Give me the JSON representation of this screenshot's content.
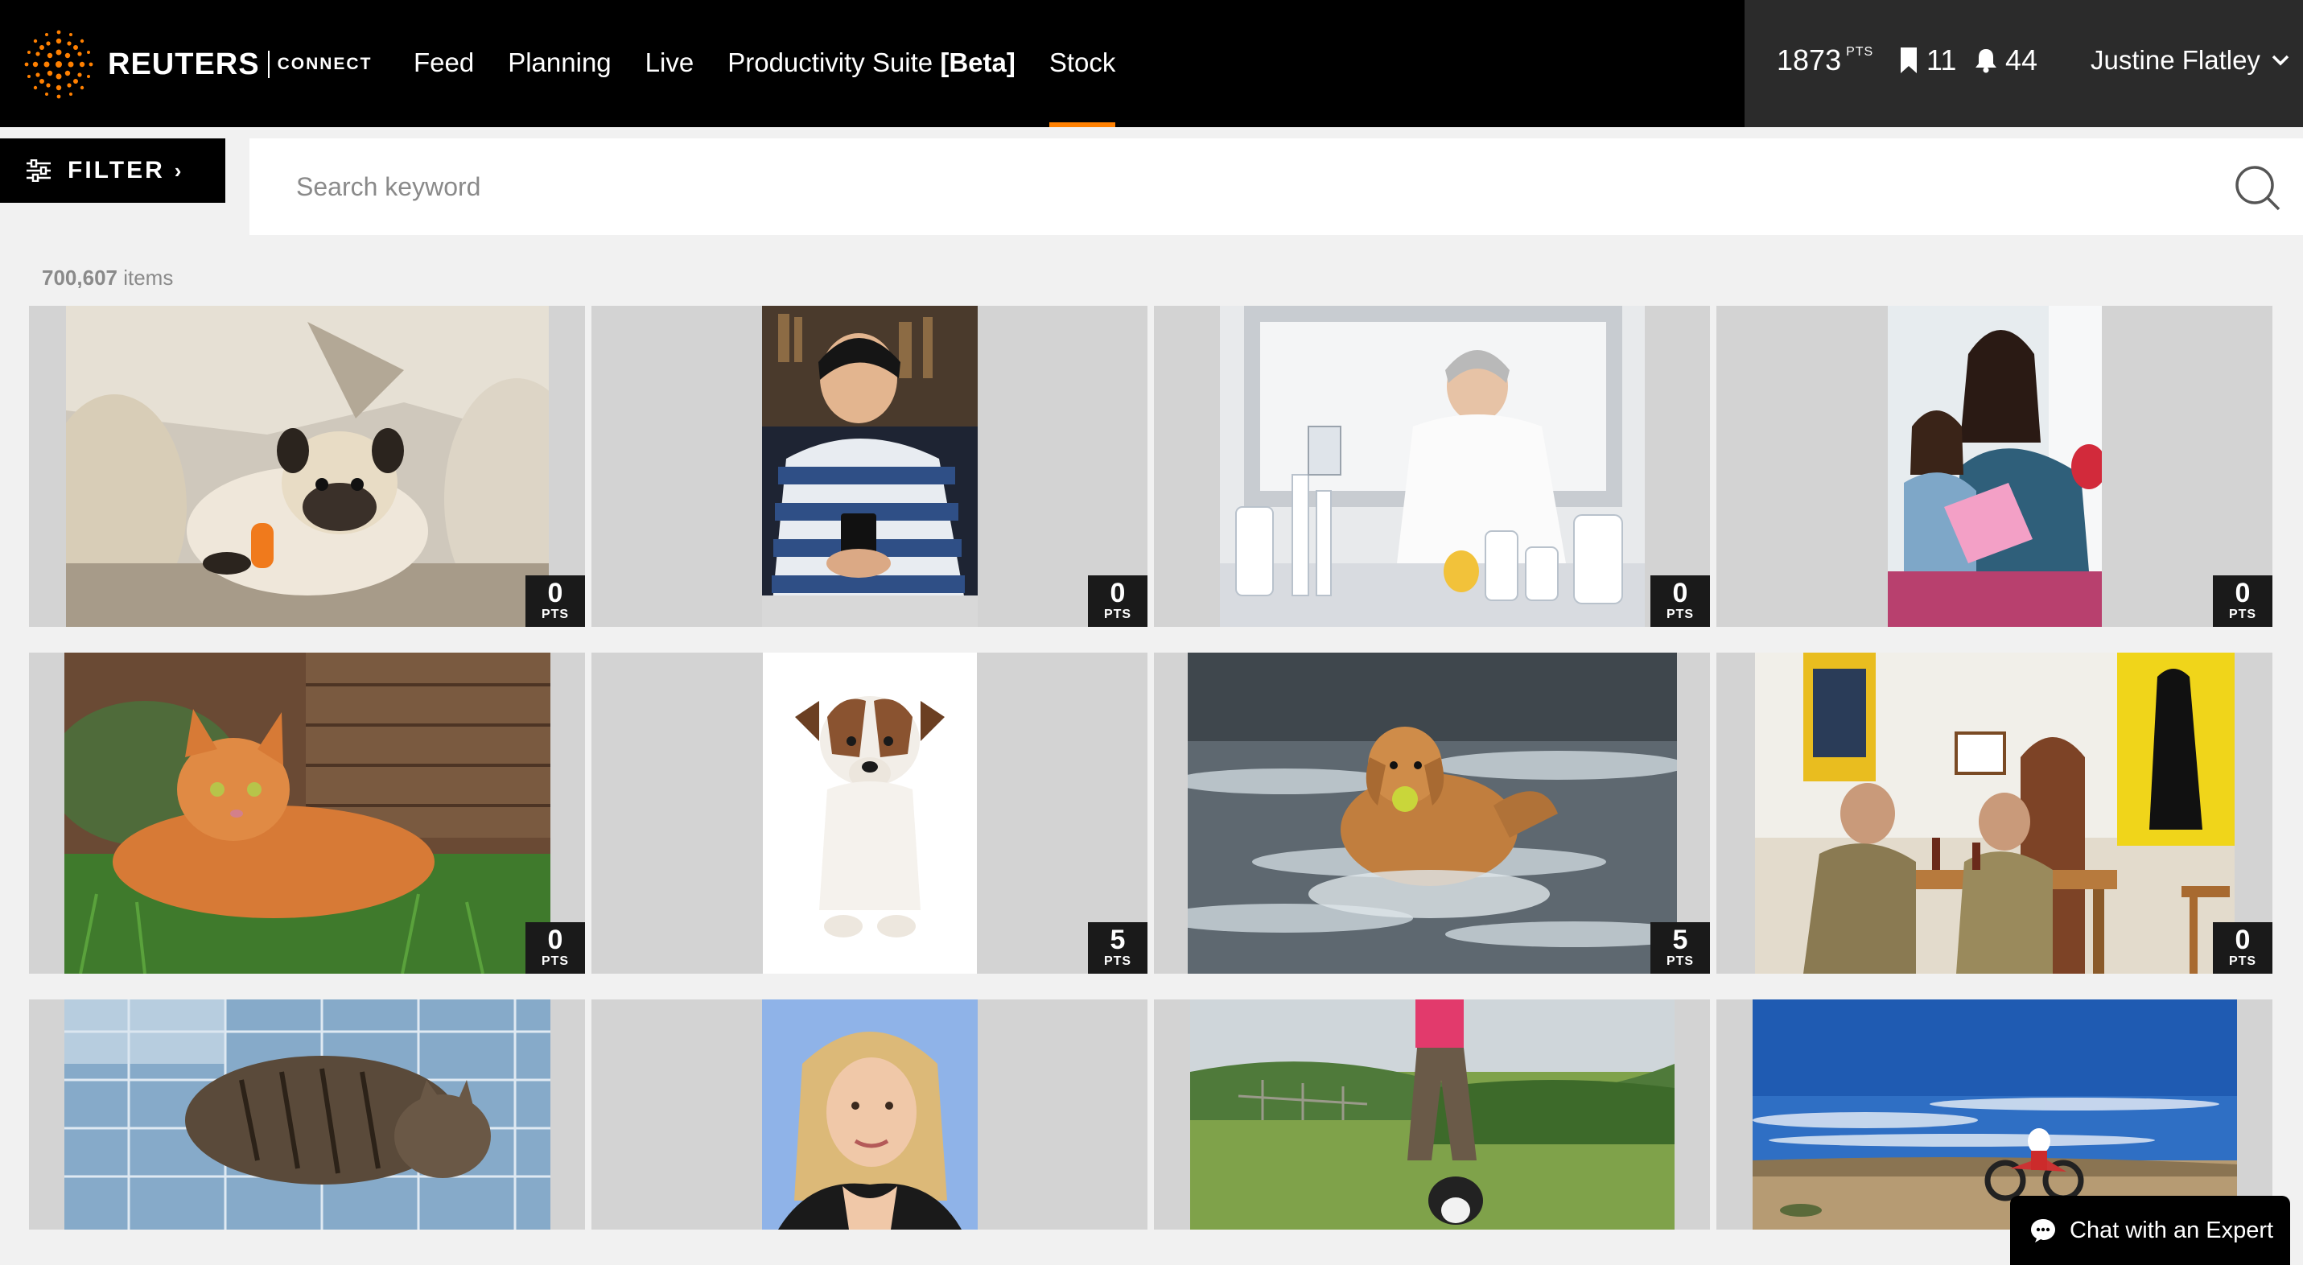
{
  "header": {
    "brand": "REUTERS",
    "brand_sub": "CONNECT",
    "nav": [
      {
        "label": "Feed"
      },
      {
        "label": "Planning"
      },
      {
        "label": "Live"
      },
      {
        "label": "Productivity Suite ",
        "tag": "[Beta]"
      },
      {
        "label": "Stock",
        "active": true
      }
    ],
    "points": "1873",
    "points_unit": "PTS",
    "bookmarks": "11",
    "notifications": "44",
    "user_name": "Justine Flatley"
  },
  "filter": {
    "label": "FILTER",
    "chevron": "›"
  },
  "search": {
    "placeholder": "Search keyword"
  },
  "results": {
    "count": "700,607",
    "unit": "items"
  },
  "tiles": [
    {
      "subject": "pug on sofa",
      "pts": "0"
    },
    {
      "subject": "teen with phone",
      "pts": "0"
    },
    {
      "subject": "lab scientist",
      "pts": "0"
    },
    {
      "subject": "mother and daughter reading",
      "pts": "0"
    },
    {
      "subject": "orange cat in grass",
      "pts": "0"
    },
    {
      "subject": "jack russell terrier",
      "pts": "5"
    },
    {
      "subject": "golden retriever in water",
      "pts": "5"
    },
    {
      "subject": "men in tavern",
      "pts": "0"
    },
    {
      "subject": "tabby cat on quilt",
      "pts": ""
    },
    {
      "subject": "blonde woman portrait",
      "pts": ""
    },
    {
      "subject": "walking dog in field",
      "pts": ""
    },
    {
      "subject": "motorcycle in desert",
      "pts": ""
    }
  ],
  "badge_unit": "PTS",
  "chat": {
    "label": "Chat with an Expert"
  },
  "colors": {
    "accent": "#ff8000",
    "header_bg": "#000000",
    "user_bg": "#2b2b2b",
    "tile_bg": "#d3d3d3",
    "page_bg": "#f1f1f1"
  }
}
